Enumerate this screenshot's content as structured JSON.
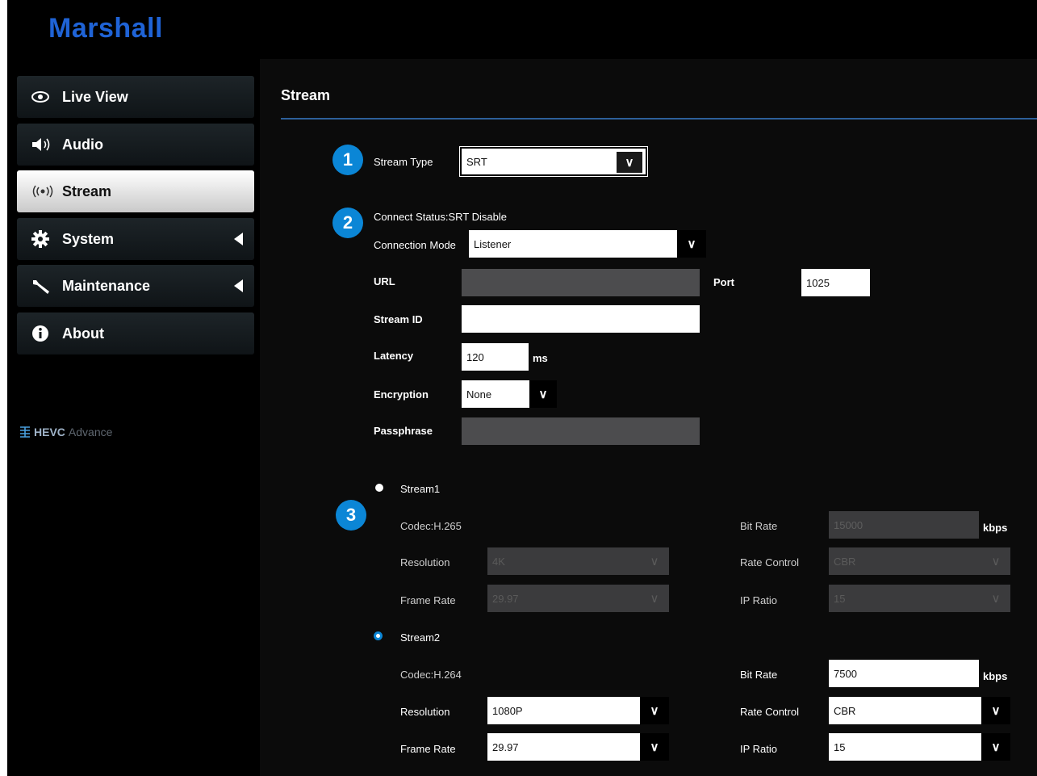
{
  "brand": {
    "logo": "Marshall",
    "hevc_bold": "HEVC",
    "hevc_light": "Advance"
  },
  "sidebar": {
    "items": [
      {
        "label": "Live View",
        "icon": "eye-icon"
      },
      {
        "label": "Audio",
        "icon": "speaker-icon"
      },
      {
        "label": "Stream",
        "icon": "broadcast-icon",
        "active": true
      },
      {
        "label": "System",
        "icon": "gear-icon",
        "expandable": true
      },
      {
        "label": "Maintenance",
        "icon": "wrench-icon",
        "expandable": true
      },
      {
        "label": "About",
        "icon": "info-icon"
      }
    ]
  },
  "page": {
    "title": "Stream"
  },
  "badges": [
    "1",
    "2",
    "3"
  ],
  "stream_type": {
    "label": "Stream Type",
    "value": "SRT"
  },
  "srt": {
    "status": "Connect Status:SRT Disable",
    "connection_mode": {
      "label": "Connection Mode",
      "value": "Listener"
    },
    "url": {
      "label": "URL",
      "value": ""
    },
    "port": {
      "label": "Port",
      "value": "1025"
    },
    "stream_id": {
      "label": "Stream ID",
      "value": ""
    },
    "latency": {
      "label": "Latency",
      "value": "120",
      "unit": "ms"
    },
    "encryption": {
      "label": "Encryption",
      "value": "None"
    },
    "passphrase": {
      "label": "Passphrase",
      "value": ""
    }
  },
  "streams": [
    {
      "name": "Stream1",
      "codec": "Codec:H.265",
      "resolution": {
        "label": "Resolution",
        "value": "4K"
      },
      "frame_rate": {
        "label": "Frame Rate",
        "value": "29.97"
      },
      "bit_rate": {
        "label": "Bit Rate",
        "value": "15000",
        "unit": "kbps"
      },
      "rate_control": {
        "label": "Rate Control",
        "value": "CBR"
      },
      "ip_ratio": {
        "label": "IP Ratio",
        "value": "15"
      }
    },
    {
      "name": "Stream2",
      "codec": "Codec:H.264",
      "resolution": {
        "label": "Resolution",
        "value": "1080P"
      },
      "frame_rate": {
        "label": "Frame Rate",
        "value": "29.97"
      },
      "bit_rate": {
        "label": "Bit Rate",
        "value": "7500",
        "unit": "kbps"
      },
      "rate_control": {
        "label": "Rate Control",
        "value": "CBR"
      },
      "ip_ratio": {
        "label": "IP Ratio",
        "value": "15"
      }
    }
  ],
  "colors": {
    "brand_blue": "#1f63d6",
    "badge_blue": "#0b86d6",
    "rule_blue": "#2d5f9a"
  }
}
